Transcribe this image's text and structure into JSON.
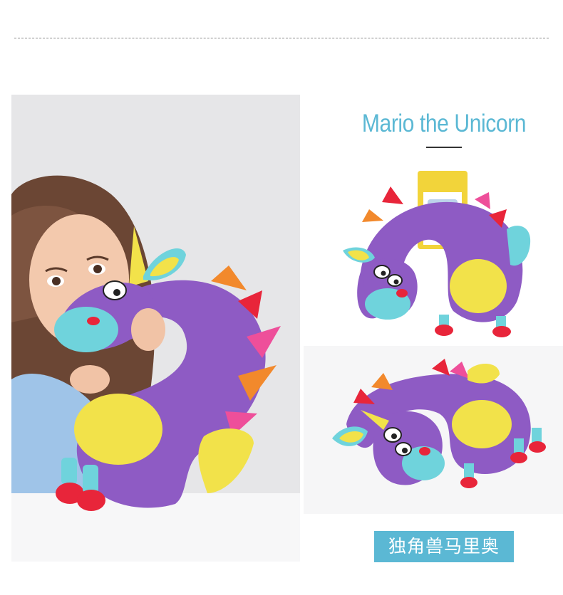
{
  "product": {
    "title": "Mario the Unicorn",
    "caption": "独角兽马里奥"
  },
  "colors": {
    "title": "#5bb8d4",
    "caption_bg": "#5bb8d4",
    "caption_text": "#ffffff",
    "plush_purple": "#8e5bc4",
    "plush_yellow": "#f2e24a",
    "plush_turquoise": "#6fd3dc",
    "plush_red": "#e8253a",
    "plush_orange": "#f2892c",
    "plush_pink": "#ee4f9a"
  },
  "images": [
    {
      "name": "girl-holding-unicorn-pillow-photo"
    },
    {
      "name": "unicorn-pillow-packaged-photo"
    },
    {
      "name": "unicorn-pillow-lying-photo"
    }
  ]
}
